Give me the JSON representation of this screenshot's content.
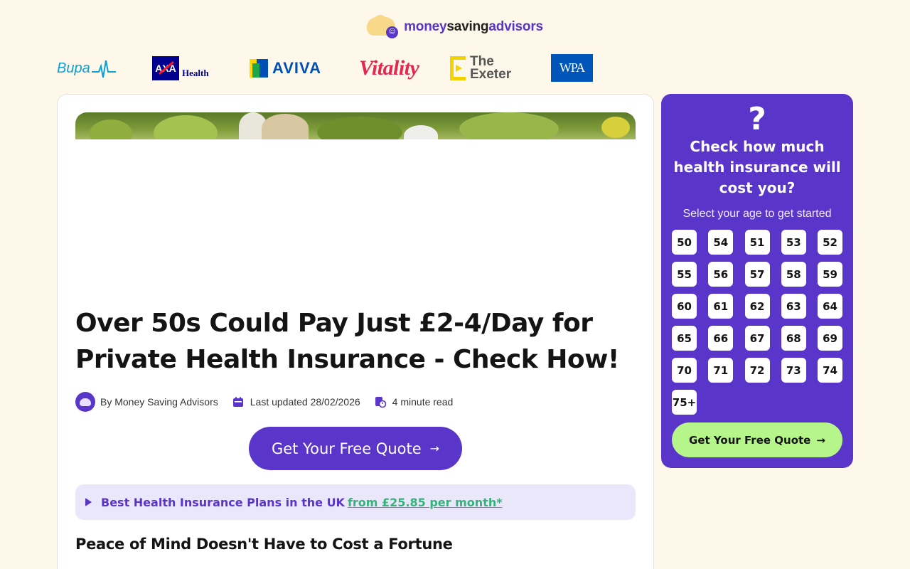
{
  "brand": {
    "part1": "money",
    "part2": "saving",
    "part3": "advisors"
  },
  "insurers": {
    "bupa": "Bupa",
    "axa": "AXA",
    "axa_sub": "Health",
    "aviva": "AVIVA",
    "vitality": "Vitality",
    "exeter_line1": "The",
    "exeter_line2": "Exeter",
    "wpa": "WPA"
  },
  "article": {
    "title": "Over 50s Could Pay Just £2-4/Day for Private Health Insurance - Check How!",
    "author": "By Money Saving Advisors",
    "updated": "Last updated 28/02/2026",
    "read_time": "4 minute read",
    "cta_label": "Get Your Free Quote",
    "banner_label": "Best Health Insurance Plans in the UK",
    "banner_price": "from £25.85 per month*",
    "subhead": "Peace of Mind Doesn't Have to Cost a Fortune"
  },
  "widget": {
    "qmark": "?",
    "title": "Check how much health insurance will cost you?",
    "subtitle": "Select your age to get started",
    "ages": [
      "50",
      "54",
      "51",
      "53",
      "52",
      "55",
      "56",
      "57",
      "58",
      "59",
      "60",
      "61",
      "62",
      "63",
      "64",
      "65",
      "66",
      "67",
      "68",
      "69",
      "70",
      "71",
      "72",
      "73",
      "74",
      "75+"
    ],
    "cta_label": "Get Your Free Quote"
  },
  "colors": {
    "background": "#fdf8e9",
    "brand_purple": "#5a35c9",
    "cta_green": "#b6f58a",
    "price_green": "#35b37a",
    "banner_bg": "#ebe7fb"
  }
}
